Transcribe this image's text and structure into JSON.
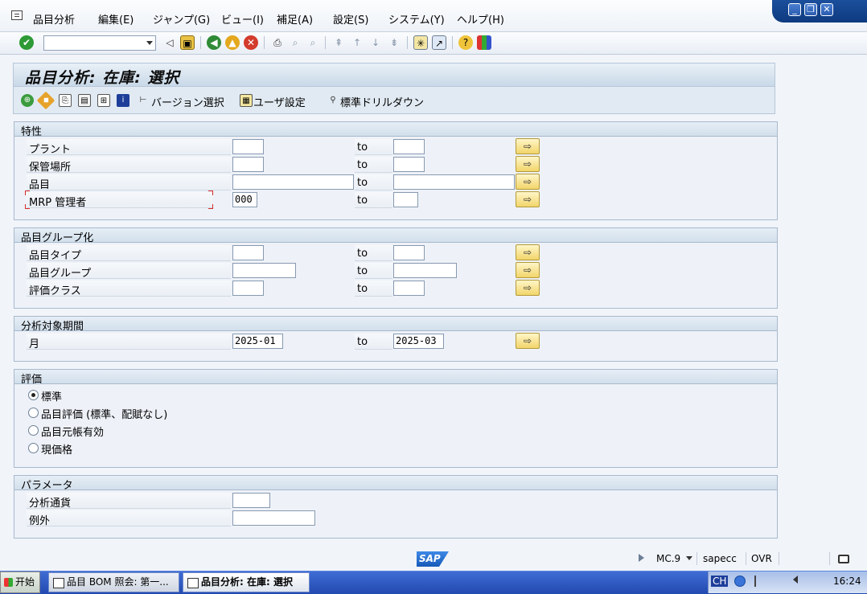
{
  "menu": {
    "items": [
      "品目分析",
      "編集(E)",
      "ジャンプ(G)",
      "ビュー(I)",
      "補足(A)",
      "設定(S)",
      "システム(Y)",
      "ヘルプ(H)"
    ]
  },
  "window_controls": {
    "minimize": "_",
    "restore": "❐",
    "close": "✕"
  },
  "toolbar": {
    "command_field_value": ""
  },
  "title": "品目分析: 在庫: 選択",
  "app_toolbar": {
    "version_select": "バージョン選択",
    "user_settings": "ユーザ設定",
    "std_drilldown": "標準ドリルダウン"
  },
  "groups": {
    "characteristics": {
      "title": "特性",
      "rows": [
        {
          "label": "プラント",
          "from": "",
          "to_label": "to",
          "to": ""
        },
        {
          "label": "保管場所",
          "from": "",
          "to_label": "to",
          "to": ""
        },
        {
          "label": "品目",
          "from": "",
          "to_label": "to",
          "to": ""
        },
        {
          "label": "MRP 管理者",
          "from": "000",
          "to_label": "to",
          "to": ""
        }
      ]
    },
    "grouping": {
      "title": "品目グループ化",
      "rows": [
        {
          "label": "品目タイプ",
          "from": "",
          "to_label": "to",
          "to": ""
        },
        {
          "label": "品目グループ",
          "from": "",
          "to_label": "to",
          "to": ""
        },
        {
          "label": "評価クラス",
          "from": "",
          "to_label": "to",
          "to": ""
        }
      ]
    },
    "period": {
      "title": "分析対象期間",
      "rows": [
        {
          "label": "月",
          "from": "2025-01",
          "to_label": "to",
          "to": "2025-03"
        }
      ]
    },
    "valuation": {
      "title": "評価",
      "options": [
        "標準",
        "品目評価 (標準、配賦なし)",
        "品目元帳有効",
        "現価格"
      ],
      "selected": "標準"
    },
    "parameters": {
      "title": "パラメータ",
      "rows": [
        {
          "label": "分析通貨",
          "value": ""
        },
        {
          "label": "例外",
          "value": ""
        }
      ]
    }
  },
  "statusbar": {
    "logo": "SAP",
    "session": "MC.9",
    "server": "sapecc",
    "mode": "OVR"
  },
  "taskbar": {
    "start": "开始",
    "tasks": [
      "品目 BOM 照会: 第一...",
      "品目分析: 在庫: 選択"
    ],
    "tray_lang": "CH",
    "tray_clock": "16:24"
  },
  "colors": {
    "menu_bg": "#eef2f7",
    "group_bg": "#eef2f8",
    "arrow_btn": "#f2d56a",
    "taskbar": "#2249b0",
    "required": "#d62b2b"
  }
}
